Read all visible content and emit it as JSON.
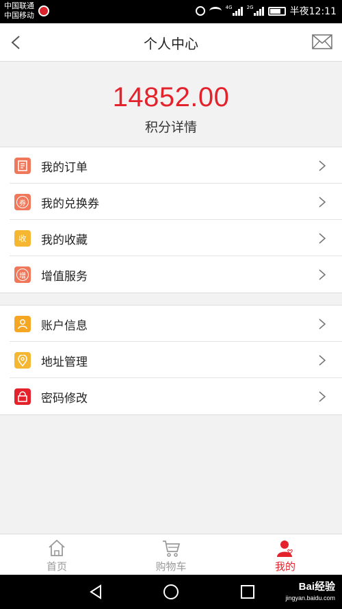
{
  "status_bar": {
    "carrier1": "中国联通",
    "carrier2": "中国移动",
    "network1": "4G",
    "network2": "2G",
    "time": "半夜12:11"
  },
  "header": {
    "title": "个人中心"
  },
  "points": {
    "value": "14852.00",
    "label": "积分详情"
  },
  "menu_group1": [
    {
      "label": "我的订单",
      "icon": "order-icon",
      "badge": "",
      "color": "#f0785a"
    },
    {
      "label": "我的兑换券",
      "icon": "coupon-icon",
      "badge": "券",
      "color": "#f0785a"
    },
    {
      "label": "我的收藏",
      "icon": "favorite-icon",
      "badge": "收",
      "color": "#f5b731"
    },
    {
      "label": "增值服务",
      "icon": "service-icon",
      "badge": "增",
      "color": "#f0785a"
    }
  ],
  "menu_group2": [
    {
      "label": "账户信息",
      "icon": "account-icon",
      "color": "#f5a623"
    },
    {
      "label": "地址管理",
      "icon": "location-icon",
      "color": "#f5b731"
    },
    {
      "label": "密码修改",
      "icon": "lock-icon",
      "color": "#e4222c"
    }
  ],
  "tabs": [
    {
      "label": "首页",
      "icon": "home-icon"
    },
    {
      "label": "购物车",
      "icon": "cart-icon"
    },
    {
      "label": "我的",
      "icon": "user-icon"
    }
  ],
  "watermark": {
    "brand": "Bai经验",
    "url": "jingyan.baidu.com"
  },
  "colors": {
    "accent": "#e4222c",
    "background": "#f2f2f2"
  }
}
